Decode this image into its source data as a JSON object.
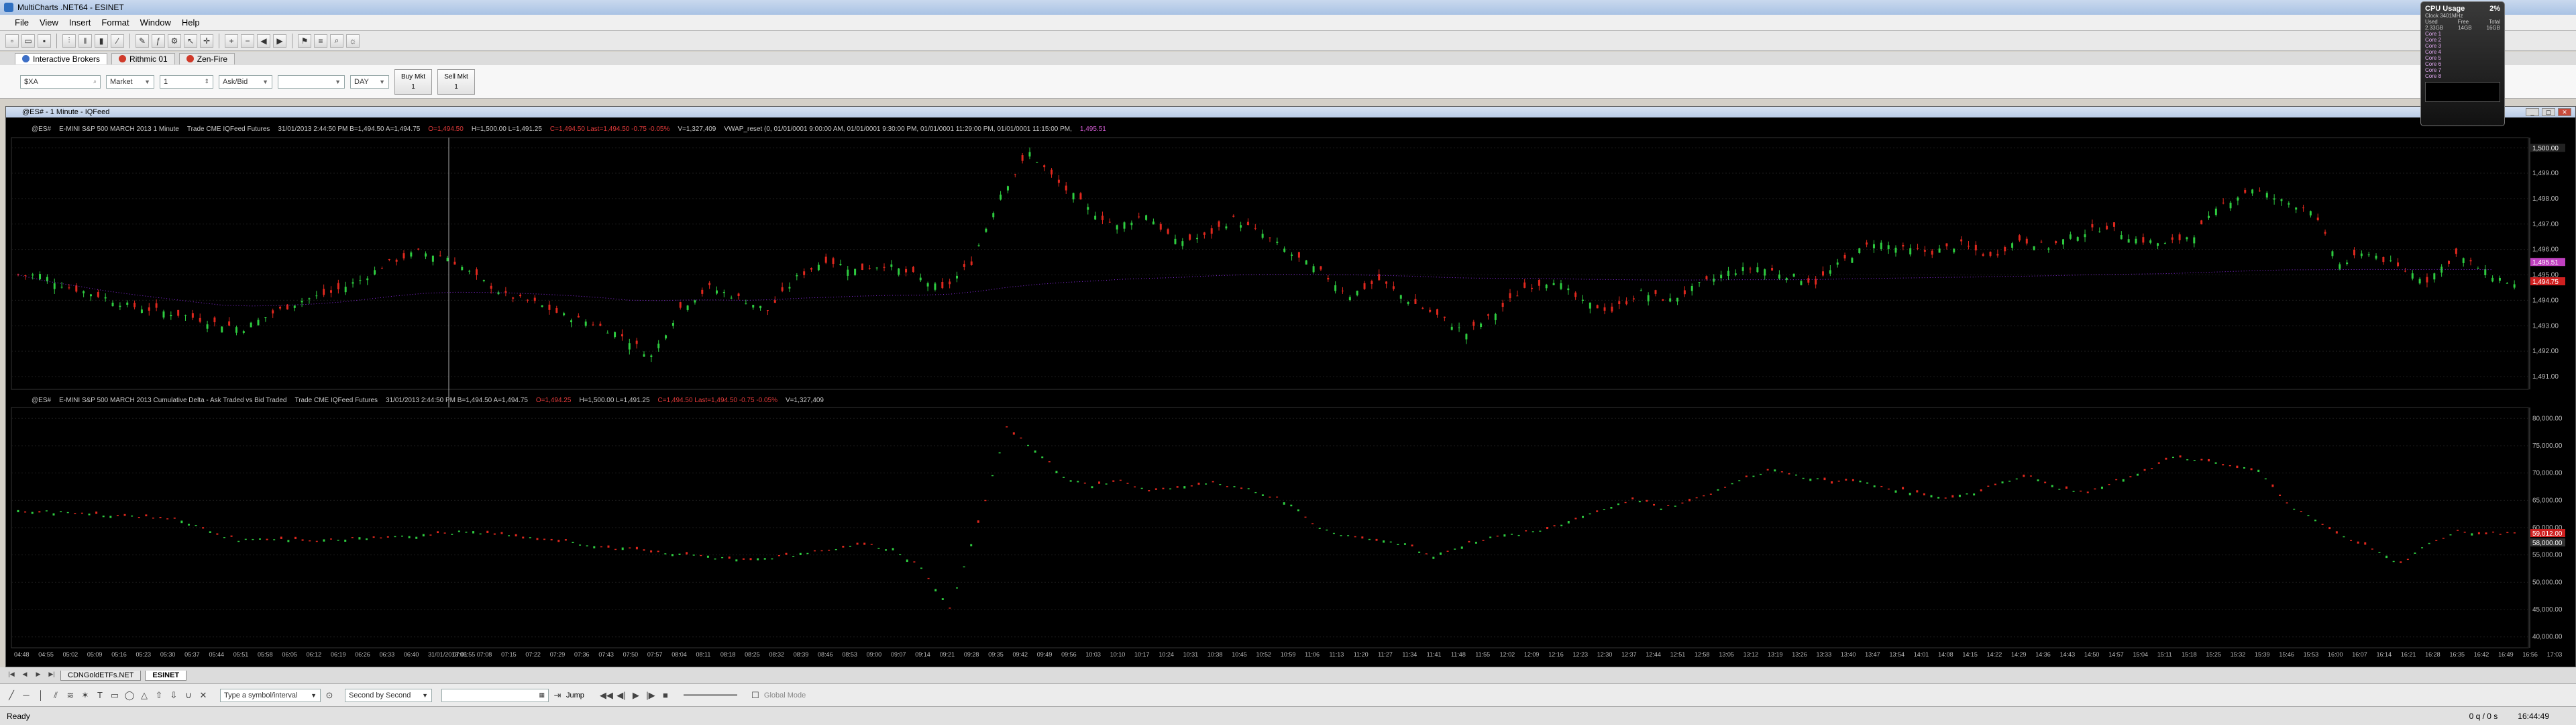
{
  "window": {
    "title": "MultiCharts .NET64 - ESINET"
  },
  "menu": [
    "File",
    "View",
    "Insert",
    "Format",
    "Window",
    "Help"
  ],
  "broker_tabs": [
    {
      "label": "Interactive Brokers",
      "active": true,
      "dot": "#d03a2a"
    },
    {
      "label": "Rithmic 01",
      "active": false,
      "dot": "#d03a2a"
    },
    {
      "label": "Zen-Fire",
      "active": false,
      "dot": "#d03a2a"
    }
  ],
  "order": {
    "symbol": "$XA",
    "order_type": "Market",
    "quantity": "1",
    "ask_bid": "Ask/Bid",
    "tif": "DAY",
    "buy": {
      "label": "Buy Mkt",
      "qty": "1"
    },
    "sell": {
      "label": "Sell Mkt",
      "qty": "1"
    }
  },
  "chart_window": {
    "title": "@ES# - 1 Minute - IQFeed"
  },
  "pane1": {
    "tag": "@ES#",
    "desc": "E-MINI S&P 500 MARCH 2013  1 Minute",
    "trade": "Trade  CME  IQFeed  Futures",
    "quote": "31/01/2013  2:44:50 PM  B=1,494.50  A=1,494.75",
    "quote_red": "O=1,494.50",
    "hl": "H=1,500.00  L=1,491.25",
    "last_red": "C=1,494.50  Last=1,494.50  -0.75  -0.05%",
    "vol": "V=1,327,409",
    "vwap": "VWAP_reset  (0,  01/01/0001 9:00:00 AM,  01/01/0001 9:30:00 PM,  01/01/0001 11:29:00 PM,  01/01/0001 11:15:00 PM,",
    "vwap_val": "1,495.51"
  },
  "pane2": {
    "tag": "@ES#",
    "desc": "E-MINI S&P 500 MARCH 2013  Cumulative Delta - Ask Traded vs Bid Traded",
    "trade": "Trade  CME  IQFeed  Futures",
    "quote": "31/01/2013  2:44:50 PM  B=1,494.50  A=1,494.75",
    "quote_red": "O=1,494.25",
    "hl": "H=1,500.00  L=1,491.25",
    "last_red": "C=1,494.50  Last=1,494.50  -0.75  -0.05%",
    "vol": "V=1,327,409"
  },
  "bottom": {
    "sheets": [
      "CDNGoldETFs.NET",
      "ESINET"
    ],
    "symbol_placeholder": "Type a symbol/interval",
    "replay_mode": "Second by Second",
    "jump": "Jump",
    "global_mode": "Global Mode"
  },
  "status": {
    "left": "Ready",
    "mid": "0 q / 0 s",
    "time": "16:44:49"
  },
  "cpu": {
    "title": "CPU Usage",
    "pct": "2%",
    "clock": "Clock 3401MHz",
    "rows": [
      [
        "Used",
        "Free",
        "Total"
      ],
      [
        "2.33GB",
        "14GB",
        "16GB"
      ]
    ],
    "cores": [
      "Core 1",
      "Core 2",
      "Core 3",
      "Core 4",
      "Core 5",
      "Core 6",
      "Core 7",
      "Core 8"
    ]
  },
  "chart_data": [
    {
      "type": "candlestick",
      "title": "E-MINI S&P 500 MARCH 2013 1 Minute",
      "ylim": [
        1490.5,
        1500.4
      ],
      "y_ticks": [
        "1,500.00",
        "1,499.00",
        "1,498.00",
        "1,497.00",
        "1,496.00",
        "1,495.00",
        "1,494.00",
        "1,493.00",
        "1,492.00",
        "1,491.00"
      ],
      "price_labels": {
        "vwap": "1,495.51",
        "last": "1,494.75",
        "bid": "1,494.50",
        "high": "1,500.00"
      },
      "series": [
        {
          "name": "Close",
          "values": [
            1495.0,
            1494.5,
            1494.2,
            1493.8,
            1493.6,
            1493.4,
            1493.1,
            1492.9,
            1493.5,
            1494.0,
            1494.3,
            1494.8,
            1495.5,
            1495.9,
            1495.7,
            1494.9,
            1494.2,
            1493.9,
            1493.4,
            1493.1,
            1492.6,
            1491.8,
            1493.7,
            1494.5,
            1494.1,
            1493.6,
            1494.9,
            1495.6,
            1495.2,
            1495.4,
            1495.0,
            1494.4,
            1495.5,
            1498.2,
            1499.8,
            1498.6,
            1497.6,
            1496.9,
            1497.4,
            1496.3,
            1496.5,
            1497.2,
            1496.6,
            1495.8,
            1495.1,
            1494.2,
            1494.8,
            1494.0,
            1493.4,
            1492.7,
            1493.5,
            1494.5,
            1494.8,
            1493.9,
            1493.6,
            1494.3,
            1494.0,
            1494.6,
            1495.1,
            1495.3,
            1495.0,
            1494.7,
            1495.6,
            1496.3,
            1496.0,
            1495.9,
            1496.2,
            1495.7,
            1496.4,
            1496.1,
            1496.6,
            1496.9,
            1496.4,
            1496.2,
            1496.6,
            1497.8,
            1498.4,
            1497.9,
            1497.6,
            1495.4,
            1495.9,
            1495.3,
            1494.8,
            1495.8,
            1495.1,
            1494.6
          ]
        }
      ]
    },
    {
      "type": "line",
      "title": "Cumulative Delta - Ask Traded vs Bid Traded",
      "ylim": [
        38000,
        82000
      ],
      "y_ticks": [
        "80,000.00",
        "75,000.00",
        "70,000.00",
        "65,000.00",
        "60,000.00",
        "55,000.00",
        "50,000.00",
        "45,000.00",
        "40,000.00"
      ],
      "price_labels": {
        "last": "59,012.00",
        "prev": "58,000.00"
      },
      "series": [
        {
          "name": "Cumulative Delta",
          "values": [
            63000,
            62700,
            62300,
            62100,
            61800,
            61400,
            59200,
            57800,
            57900,
            57700,
            57800,
            58000,
            58200,
            58400,
            58900,
            59300,
            58800,
            58200,
            57700,
            57100,
            56400,
            55900,
            55400,
            54900,
            54500,
            54200,
            54700,
            55300,
            56200,
            56800,
            56100,
            52600,
            45200,
            60800,
            78200,
            74300,
            69300,
            67800,
            68700,
            66600,
            67200,
            68300,
            67700,
            66300,
            64400,
            59700,
            58600,
            57800,
            56900,
            54700,
            56700,
            58300,
            58900,
            59600,
            61700,
            63300,
            65300,
            63700,
            64700,
            66800,
            69200,
            70600,
            69300,
            68300,
            68600,
            67300,
            66300,
            65300,
            66300,
            68600,
            69300,
            67300,
            66300,
            68600,
            70300,
            73100,
            72300,
            71300,
            70600,
            64300,
            61300,
            58300,
            56300,
            53300,
            57300,
            59200,
            58900,
            59000
          ]
        }
      ],
      "time_labels": [
        "04:48",
        "04:55",
        "05:02",
        "05:09",
        "05:16",
        "05:23",
        "05:30",
        "05:37",
        "05:44",
        "05:51",
        "05:58",
        "06:05",
        "06:12",
        "06:19",
        "06:26",
        "06:33",
        "06:40",
        "31/01/2013 06:55",
        "07:01",
        "07:08",
        "07:15",
        "07:22",
        "07:29",
        "07:36",
        "07:43",
        "07:50",
        "07:57",
        "08:04",
        "08:11",
        "08:18",
        "08:25",
        "08:32",
        "08:39",
        "08:46",
        "08:53",
        "09:00",
        "09:07",
        "09:14",
        "09:21",
        "09:28",
        "09:35",
        "09:42",
        "09:49",
        "09:56",
        "10:03",
        "10:10",
        "10:17",
        "10:24",
        "10:31",
        "10:38",
        "10:45",
        "10:52",
        "10:59",
        "11:06",
        "11:13",
        "11:20",
        "11:27",
        "11:34",
        "11:41",
        "11:48",
        "11:55",
        "12:02",
        "12:09",
        "12:16",
        "12:23",
        "12:30",
        "12:37",
        "12:44",
        "12:51",
        "12:58",
        "13:05",
        "13:12",
        "13:19",
        "13:26",
        "13:33",
        "13:40",
        "13:47",
        "13:54",
        "14:01",
        "14:08",
        "14:15",
        "14:22",
        "14:29",
        "14:36",
        "14:43",
        "14:50",
        "14:57",
        "15:04",
        "15:11",
        "15:18",
        "15:25",
        "15:32",
        "15:39",
        "15:46",
        "15:53",
        "16:00",
        "16:07",
        "16:14",
        "16:21",
        "16:28",
        "16:35",
        "16:42",
        "16:49",
        "16:56",
        "17:03"
      ]
    }
  ]
}
